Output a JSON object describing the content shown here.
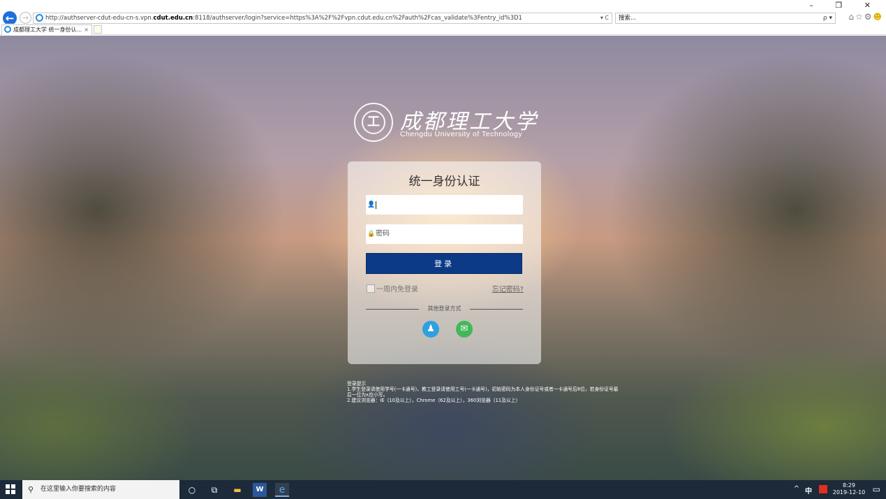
{
  "browser": {
    "url_prefix": "http://authserver-cdut-edu-cn-s.vpn.",
    "url_domain": "cdut.edu.cn",
    "url_rest": ":8118/authserver/login?service=https%3A%2F%2Fvpn.cdut.edu.cn%2Fauth%2Fcas_validate%3Fentry_id%3D1",
    "url_tools": "▾ C",
    "search_text": "搜索...",
    "search_go": "ρ ▾",
    "window_controls": "– ❐ ✕",
    "tab_title": "成都理工大学 统一身份认...",
    "tab_close": "×"
  },
  "logo": {
    "seal_glyph": "工",
    "name_cn": "成都理工大学",
    "name_en": "Chengdu University of Technology"
  },
  "login": {
    "title": "统一身份认证",
    "username_value": "",
    "password_placeholder": "密码",
    "button_label": "登录",
    "remember_label": "一周内免登录",
    "forgot_label": "忘记密码?",
    "other_methods_label": "其他登录方式"
  },
  "tips": {
    "heading": "登录提示",
    "line1": "1.学生登录请使用学号(一卡通号)，教工登录请使用工号(一卡通号)，初始密码为本人身份证号或者一卡通号后8位，若身份证号最后一位为x应小写。",
    "line2": "2.建议浏览器：IE（10及以上），Chrome（62及以上），360浏览器（11及以上）"
  },
  "taskbar": {
    "search_placeholder": "在这里输入你要搜索的内容",
    "tray_up": "^",
    "ime": "中",
    "time": "8:29",
    "date": "2019-12-10"
  },
  "colors": {
    "login_button": "#0c3a86",
    "qq": "#2fa0e0",
    "wechat": "#43b85a",
    "taskbar": "#1c2a3a"
  },
  "icons": {
    "back": "arrow-left-icon",
    "forward": "arrow-right-icon",
    "user": "user-icon",
    "lock": "lock-icon",
    "qq": "qq-icon",
    "wechat": "wechat-icon",
    "home": "home-icon",
    "star": "star-icon",
    "gear": "gear-icon",
    "feedback": "smiley-icon"
  }
}
